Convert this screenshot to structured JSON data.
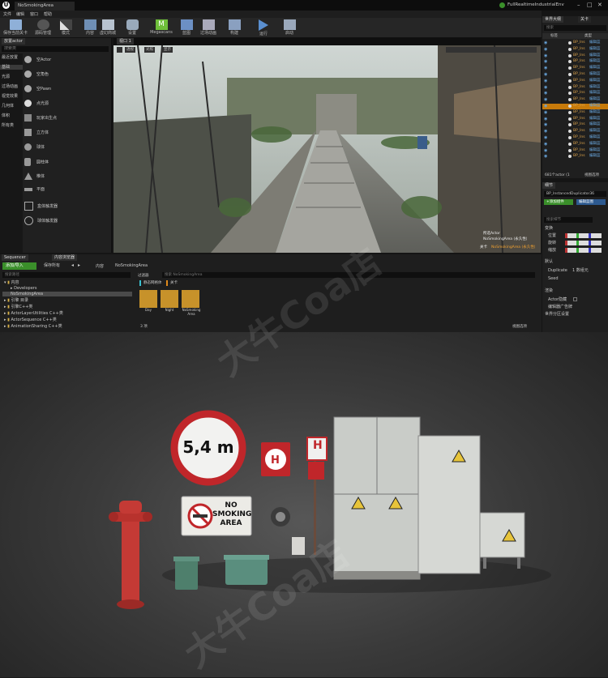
{
  "window": {
    "tab_title": "NoSmokingArea",
    "project_name": "FullRealtimeIndustrialEnv"
  },
  "menu": [
    "文件",
    "编辑",
    "窗口",
    "帮助"
  ],
  "toolbar": [
    {
      "label": "保存当前关卡",
      "icon": "save-icon"
    },
    {
      "label": "源码管理",
      "icon": "source-control-icon"
    },
    {
      "label": "模式",
      "icon": "modes-icon"
    },
    {
      "label": "内容",
      "icon": "content-icon"
    },
    {
      "label": "虚幻商城",
      "icon": "marketplace-icon"
    },
    {
      "label": "设置",
      "icon": "settings-icon"
    },
    {
      "label": "Megascans",
      "icon": "megascans-icon"
    },
    {
      "label": "蓝图",
      "icon": "blueprint-icon"
    },
    {
      "label": "过场动画",
      "icon": "cinematics-icon"
    },
    {
      "label": "构建",
      "icon": "build-icon"
    },
    {
      "label": "运行",
      "icon": "play-icon"
    },
    {
      "label": "启动",
      "icon": "launch-icon"
    }
  ],
  "place_actors": {
    "tab": "放置actor",
    "search_placeholder": "搜索类",
    "categories": [
      "最近放置",
      "基础",
      "光源",
      "过场动画",
      "视觉效果",
      "几何体",
      "体积",
      "所有类"
    ],
    "items": [
      "空Actor",
      "空角色",
      "空Pawn",
      "点光源",
      "玩家出生点",
      "立方体",
      "球体",
      "圆柱体",
      "椎体",
      "平面",
      "盒体触发器",
      "球体触发器"
    ]
  },
  "viewport": {
    "tab": "视口 1",
    "view_modes": [
      "透视",
      "光照",
      "显示"
    ],
    "info_line1": "所选Actor",
    "info_line2": "NoSmokingArea (永久性)",
    "level_label": "关卡",
    "level_name": "NoSmokingArea (永久性)"
  },
  "outliner": {
    "tabs": [
      "世界大纲",
      "关卡"
    ],
    "search_placeholder": "搜索",
    "columns": [
      "标签",
      "类型"
    ],
    "items": [
      {
        "label": "BP_Ins",
        "type": "编辑蓝",
        "selected": false
      },
      {
        "label": "BP_Ins",
        "type": "编辑蓝",
        "selected": false
      },
      {
        "label": "BP_Ins",
        "type": "编辑蓝",
        "selected": false
      },
      {
        "label": "BP_Ins",
        "type": "编辑蓝",
        "selected": false
      },
      {
        "label": "BP_Ins",
        "type": "编辑蓝",
        "selected": false
      },
      {
        "label": "BP_Ins",
        "type": "编辑蓝",
        "selected": false
      },
      {
        "label": "BP_Ins",
        "type": "编辑蓝",
        "selected": false
      },
      {
        "label": "BP_Ins",
        "type": "编辑蓝",
        "selected": false
      },
      {
        "label": "BP_Ins",
        "type": "编辑蓝",
        "selected": false
      },
      {
        "label": "BP_Ins",
        "type": "编辑蓝",
        "selected": false
      },
      {
        "label": "BP_Ins",
        "type": "编辑蓝",
        "selected": true
      },
      {
        "label": "BP_Ins",
        "type": "编辑蓝",
        "selected": false
      },
      {
        "label": "BP_Ins",
        "type": "编辑蓝",
        "selected": false
      },
      {
        "label": "BP_Ins",
        "type": "编辑蓝",
        "selected": false
      },
      {
        "label": "BP_Ins",
        "type": "编辑蓝",
        "selected": false
      },
      {
        "label": "BP_Ins",
        "type": "编辑蓝",
        "selected": false
      },
      {
        "label": "BP_Ins",
        "type": "编辑蓝",
        "selected": false
      },
      {
        "label": "BP_Ins",
        "type": "编辑蓝",
        "selected": false
      },
      {
        "label": "BP_Ins",
        "type": "编辑蓝",
        "selected": false
      }
    ],
    "count_text": "681个actor (1",
    "view_options": "视图选项"
  },
  "details": {
    "tab": "细节",
    "object_name": "BP_InstancedDuplicator36",
    "add_component": "+添加组件",
    "edit_blueprint": "编辑蓝图",
    "search_placeholder": "搜索细节",
    "sections": {
      "transform": "变换",
      "location": "位置",
      "rotation": "旋转",
      "scale": "缩放",
      "default": "默认",
      "duplicate": "Duplicate",
      "duplicate_value": "1 数组元",
      "seed": "Seed",
      "render": "渲染",
      "actor_hidden": "Actor隐藏",
      "editor_billboard": "编辑器广告牌",
      "world_partition": "世界分区设置"
    }
  },
  "content_browser": {
    "tabs": [
      "Sequencer",
      "内容浏览器"
    ],
    "add_import": "添加/导入",
    "save_all": "保存所有",
    "breadcrumb": [
      "内容",
      "NoSmokingArea"
    ],
    "search_placeholder": "搜索路径",
    "filter_label": "过滤器",
    "search_assets": "搜索 NoSmokingArea",
    "tree": [
      "内容",
      "Developers",
      "NoSmokingArea",
      "引擎 目录",
      "引擎C++类",
      "ActorLayerUtilities C++类",
      "ActorSequence C++类",
      "AnimationSharing C++类"
    ],
    "chips": [
      "静态网格体",
      "关卡"
    ],
    "assets": [
      "Day",
      "Night",
      "NoSmoking Area"
    ],
    "item_count": "3 项",
    "view_options": "视图选项"
  },
  "product": {
    "speed_sign": "5,4 m",
    "no_smoking_line1": "NO",
    "no_smoking_line2": "SMOKING",
    "no_smoking_line3": "AREA",
    "hydrant_sign_letter": "H",
    "watermark": "大牛Coa店"
  },
  "colors": {
    "accent_green": "#3a8f2a",
    "selected_orange": "#c77a0a",
    "sign_red": "#c0262a",
    "cabinet": "#c9ccc8"
  }
}
